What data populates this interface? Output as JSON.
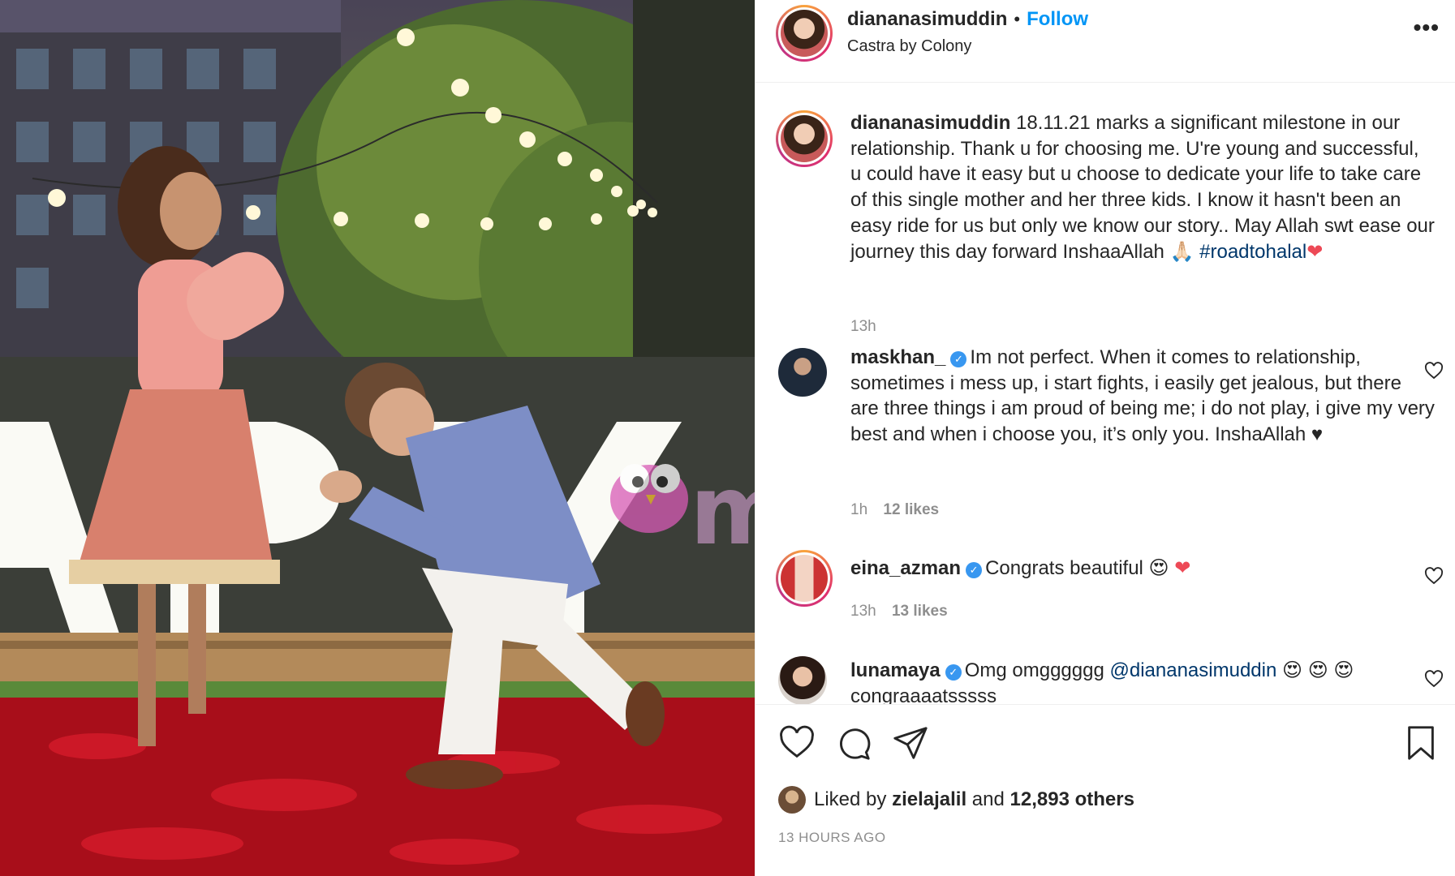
{
  "post": {
    "username": "diananasimuddin",
    "follow_label": "Follow",
    "separator": "•",
    "location": "Castra by Colony",
    "more_label": "•••"
  },
  "caption": {
    "username": "diananasimuddin",
    "text": "18.11.21 marks a significant milestone in our relationship. Thank u for choosing me. U're young and successful, u could have it easy but u choose to dedicate your life to take care of this single mother and her three kids. I know it hasn't been an easy ride for us but only we know our story.. May Allah swt ease our journey this day forward InshaaAllah",
    "emoji": "🙏🏻",
    "hashtag": "#roadtohalal",
    "heart": "❤",
    "time": "13h"
  },
  "comments": [
    {
      "username": "maskhan_",
      "verified": true,
      "text": "Im not perfect. When it comes to relationship, sometimes i mess up, i start fights, i easily get jealous, but there are three things i am proud of being me; i do not play, i give my very best and when i choose you, it’s only you. InshaAllah ♥",
      "time": "1h",
      "likes": "12 likes"
    },
    {
      "username": "eina_azman",
      "verified": true,
      "text": "Congrats beautiful",
      "emoji": "😍",
      "heart": "❤",
      "time": "13h",
      "likes": "13 likes"
    },
    {
      "username": "lunamaya",
      "verified": true,
      "text": "Omg omgggggg",
      "mention": "@diananasimuddin",
      "emoji": "😍 😍 😍",
      "text2": "congraaaatsssss"
    }
  ],
  "actions": {
    "liked_by_prefix": "Liked by",
    "liked_by_user": "zielajalil",
    "liked_by_and": "and",
    "liked_by_others": "12,893 others",
    "time_ago": "13 HOURS AGO"
  },
  "watermark": "murai",
  "colors": {
    "accent": "#0095f6",
    "verified": "#3897f0",
    "muted": "#8e8e8e",
    "heart": "#ed4956"
  }
}
